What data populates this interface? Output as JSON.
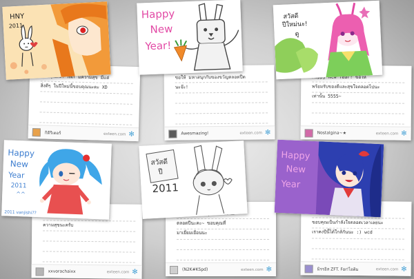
{
  "cards": [
    {
      "art_text": [
        "HNY",
        "2011"
      ],
      "message": "ขอบคุณค่ะ! HNY มีความสุข มีแต่\nสิ่งดีๆ ในปีใหม่นี้ขอบคุณนะคะ XD",
      "username": "กิติริเตอร์",
      "brand": "exteen.com",
      "avatar_color": "#e8a14a"
    },
    {
      "art_text": [
        "Happy",
        "New",
        "Year!"
      ],
      "message": "ขอให้ มหาสนุกกับของขวัญตลอดปีด\nนะจ๊ะ!",
      "username": "Awesmazing!",
      "brand": "exteen.com",
      "avatar_color": "#5a5a5a"
    },
    {
      "art_text": [
        "สวัสดี",
        "ปีใหม่นะ!",
        "ดู"
      ],
      "message": "Happy New Year! ขอให้\nพร้อมรับของดีและสุขใจตลอดไปนะ\nเท่านั้น 5555~",
      "username": "Nostalgina~★",
      "brand": "exteen.com",
      "avatar_color": "#d26aa8"
    },
    {
      "art_text": [
        "Happy",
        "New",
        "Year",
        "2011",
        "^^",
        "2011 vanjishi??"
      ],
      "message": "สวัสดีปีใหม่ด้วยนะครับ ขอให้มี\nความสุขนะครับ",
      "username": "xxvorachaixx",
      "brand": "exteen.com",
      "avatar_color": "#b5b5b5"
    },
    {
      "art_text": [
        "สวัสดี",
        "ปี",
        "2011"
      ],
      "message": "สวัสดีปีใหม่นะ สุขสันต์ สดใส\nตลอดปีนะคะ~ ขอบคุณที่\nมาเยี่ยมเยือนนะ",
      "username": "(N2K#KSpd)",
      "brand": "exteen.com",
      "avatar_color": "#cfcfcf"
    },
    {
      "art_text": [
        "Happy",
        "New",
        "Year"
      ],
      "message": "HNY 2011 ด้วย ปีนี้คงจะ...\nขอบคุณเป็นกำลังใจตลอดเวลาเลยนะ\nเราคงปีนี้ได้ใกล้กันนะ :) wcd",
      "username": "มิรรอิส ZFT. For!ไอติม",
      "brand": "exteen.com",
      "avatar_color": "#9a8fd0"
    }
  ]
}
